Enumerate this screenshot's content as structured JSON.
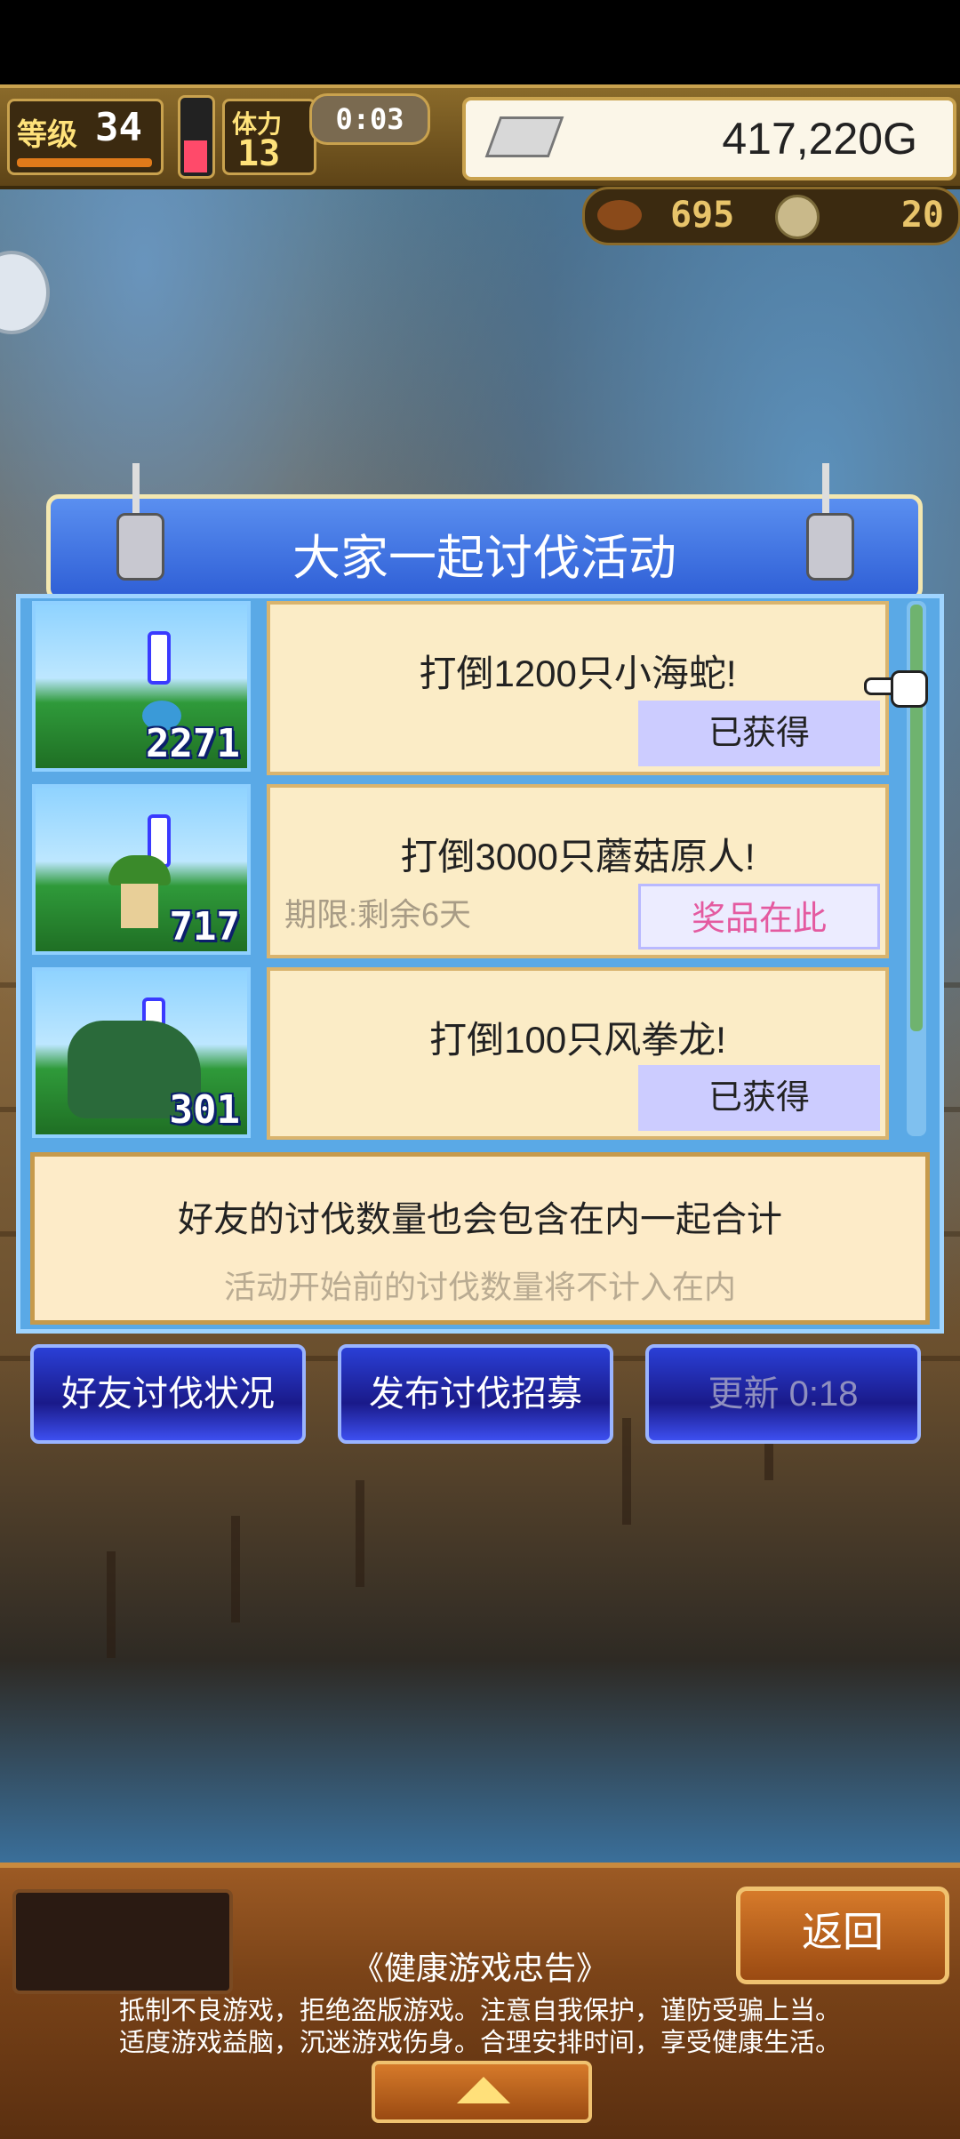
{
  "hud": {
    "level_label": "等级",
    "level_value": "34",
    "stamina_label": "体力",
    "stamina_value": "13",
    "timer": "0:03",
    "gold": "417,220G",
    "res_a": "695",
    "res_b": "20"
  },
  "dialog": {
    "title": "大家一起讨伐活动",
    "quests": [
      {
        "thumb_count": "2271",
        "title": "打倒1200只小海蛇!",
        "status": "已获得",
        "deadline": ""
      },
      {
        "thumb_count": "717",
        "title": "打倒3000只蘑菇原人!",
        "status": "奖品在此",
        "deadline": "期限:剩余6天"
      },
      {
        "thumb_count": "301",
        "title": "打倒100只风拳龙!",
        "status": "已获得",
        "deadline": ""
      }
    ],
    "note_line1": "好友的讨伐数量也会包含在内一起合计",
    "note_line2": "活动开始前的讨伐数量将不计入在内"
  },
  "actions": {
    "friends_status": "好友讨伐状况",
    "post_recruit": "发布讨伐招募",
    "refresh": "更新 0:18"
  },
  "footer": {
    "back": "返回",
    "notice_title": "《健康游戏忠告》",
    "notice_line1": "抵制不良游戏，拒绝盗版游戏。注意自我保护，谨防受骗上当。",
    "notice_line2": "适度游戏益脑，沉迷游戏伤身。合理安排时间，享受健康生活。"
  },
  "colors": {
    "dialog_blue": "#5aa9e6",
    "prize_pink": "#e45aa0",
    "claimed_bg": "#ccccff"
  }
}
